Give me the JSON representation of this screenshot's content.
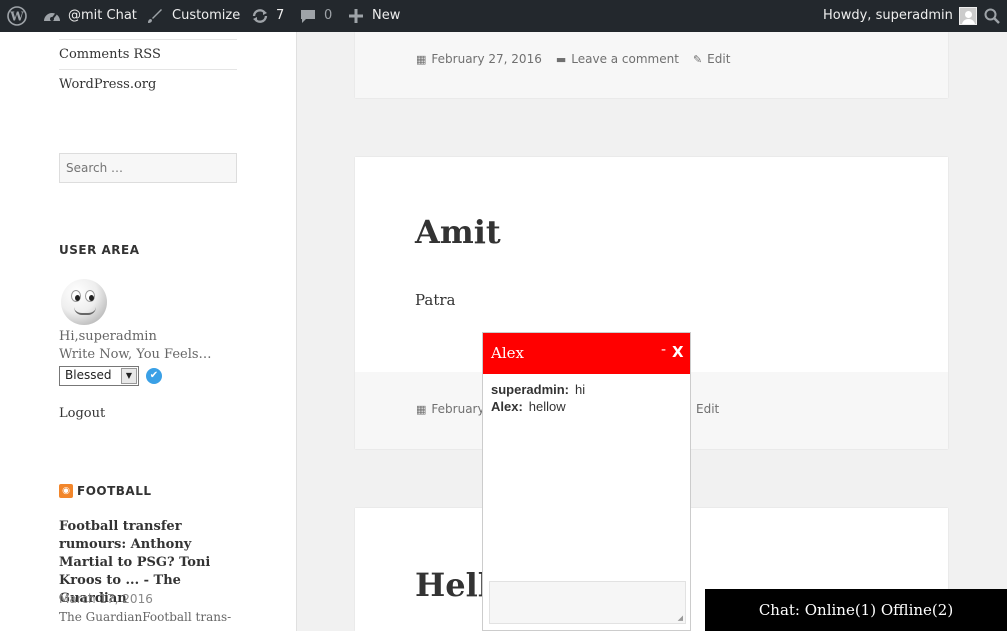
{
  "adminbar": {
    "site_name": "@mit Chat",
    "customize": "Customize",
    "updates_count": "7",
    "comments_count": "0",
    "new_label": "New",
    "howdy": "Howdy, superadmin"
  },
  "sidebar": {
    "comments_rss": "Comments RSS",
    "wordpress_org": "WordPress.org",
    "search_placeholder": "Search …",
    "user_area_title": "USER AREA",
    "greeting": "Hi,superadmin",
    "feels_label": "Write Now, You Feels…",
    "mood_selected": "Blessed",
    "logout": "Logout",
    "football_title": "FOOTBALL",
    "news_title": "Football transfer rumours: Anthony Martial to PSG? Toni Kroos to ... - The Guardian",
    "news_date": "March 17, 2016",
    "news_excerpt": "The GuardianFootball trans-"
  },
  "posts": [
    {
      "date": "February 27, 2016",
      "comment": "Leave a comment",
      "edit": "Edit"
    },
    {
      "title": "Amit",
      "body": "Patra",
      "date_partial": "February",
      "edit": "Edit"
    },
    {
      "title_partial": "Hell"
    }
  ],
  "chat": {
    "partner": "Alex",
    "minimize": "-",
    "close": "X",
    "messages": [
      {
        "sender": "superadmin:",
        "text": "hi"
      },
      {
        "sender": "Alex:",
        "text": "hellow"
      }
    ],
    "status_bar": "Chat: Online(1) Offline(2)"
  },
  "colors": {
    "adminbar_bg": "#23282d",
    "chat_header": "#ff0000",
    "status_bar_bg": "#000000"
  }
}
